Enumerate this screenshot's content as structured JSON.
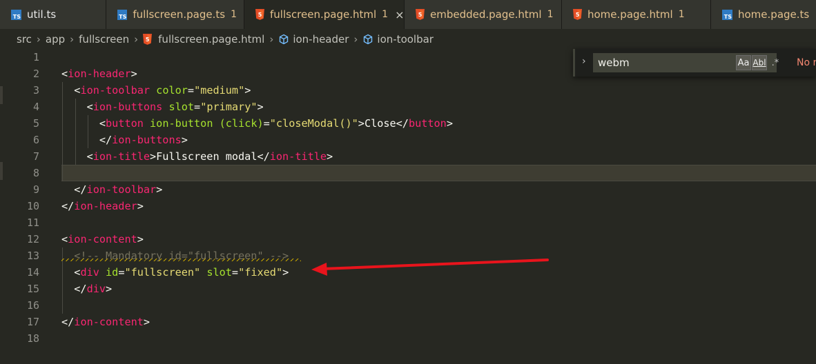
{
  "tabs": [
    {
      "icon": "ts",
      "label": "util.ts",
      "label_color": "#e8e8e8",
      "badge": "",
      "active": false,
      "closable": false
    },
    {
      "icon": "ts",
      "label": "fullscreen.page.ts",
      "label_color": "#e2c08d",
      "badge": "1",
      "active": false,
      "closable": false
    },
    {
      "icon": "html",
      "label": "fullscreen.page.html",
      "label_color": "#e2c08d",
      "badge": "1",
      "active": true,
      "closable": true
    },
    {
      "icon": "html",
      "label": "embedded.page.html",
      "label_color": "#e2c08d",
      "badge": "1",
      "active": false,
      "closable": false
    },
    {
      "icon": "html",
      "label": "home.page.html",
      "label_color": "#e2c08d",
      "badge": "1",
      "active": false,
      "closable": false
    },
    {
      "icon": "ts",
      "label": "home.page.ts",
      "label_color": "#e2c08d",
      "badge": "",
      "active": false,
      "closable": false
    }
  ],
  "tab_icon_text": "TS",
  "tab_close": "×",
  "breadcrumb": {
    "sep": "›",
    "items": [
      "src",
      "app",
      "fullscreen",
      "fullscreen.page.html",
      "ion-header",
      "ion-toolbar"
    ]
  },
  "find": {
    "chevron": "›",
    "value": "webm",
    "match_case": "Aa",
    "whole_word": "Abl",
    "regex": ".*",
    "status": "No results"
  },
  "editor": {
    "current_line": 8,
    "lines": [
      {
        "n": "1",
        "tokens": []
      },
      {
        "n": "2",
        "tokens": [
          [
            "p",
            "<"
          ],
          [
            "t",
            "ion-header"
          ],
          [
            "p",
            ">"
          ]
        ]
      },
      {
        "n": "3",
        "tokens": [
          [
            "p",
            "  <"
          ],
          [
            "t",
            "ion-toolbar"
          ],
          [
            "a",
            " color"
          ],
          [
            "p",
            "="
          ],
          [
            "s",
            "\"medium\""
          ],
          [
            "p",
            ">"
          ]
        ]
      },
      {
        "n": "4",
        "tokens": [
          [
            "p",
            "    <"
          ],
          [
            "t",
            "ion-buttons"
          ],
          [
            "a",
            " slot"
          ],
          [
            "p",
            "="
          ],
          [
            "s",
            "\"primary\""
          ],
          [
            "p",
            ">"
          ]
        ]
      },
      {
        "n": "5",
        "tokens": [
          [
            "p",
            "      <"
          ],
          [
            "t",
            "button"
          ],
          [
            "a",
            " ion-button (click)"
          ],
          [
            "p",
            "="
          ],
          [
            "s",
            "\"closeModal()\""
          ],
          [
            "p",
            ">Close</"
          ],
          [
            "t",
            "button"
          ],
          [
            "p",
            ">"
          ]
        ]
      },
      {
        "n": "6",
        "tokens": [
          [
            "p",
            "      </"
          ],
          [
            "t",
            "ion-buttons"
          ],
          [
            "p",
            ">"
          ]
        ]
      },
      {
        "n": "7",
        "tokens": [
          [
            "p",
            "    <"
          ],
          [
            "t",
            "ion-title"
          ],
          [
            "p",
            ">Fullscreen modal</"
          ],
          [
            "t",
            "ion-title"
          ],
          [
            "p",
            ">"
          ]
        ]
      },
      {
        "n": "8",
        "tokens": []
      },
      {
        "n": "9",
        "tokens": [
          [
            "p",
            "  </"
          ],
          [
            "t",
            "ion-toolbar"
          ],
          [
            "p",
            ">"
          ]
        ]
      },
      {
        "n": "10",
        "tokens": [
          [
            "p",
            "</"
          ],
          [
            "t",
            "ion-header"
          ],
          [
            "p",
            ">"
          ]
        ]
      },
      {
        "n": "11",
        "tokens": []
      },
      {
        "n": "12",
        "tokens": [
          [
            "p",
            "<"
          ],
          [
            "t",
            "ion-content"
          ],
          [
            "p",
            ">"
          ]
        ]
      },
      {
        "n": "13",
        "tokens": [
          [
            "c",
            "  <!-- Mandatory id=\"fullscreen\" -->"
          ]
        ]
      },
      {
        "n": "14",
        "tokens": [
          [
            "p",
            "  <"
          ],
          [
            "t",
            "div"
          ],
          [
            "a",
            " id"
          ],
          [
            "p",
            "="
          ],
          [
            "s",
            "\"fullscreen\""
          ],
          [
            "a",
            " slot"
          ],
          [
            "p",
            "="
          ],
          [
            "s",
            "\"fixed\""
          ],
          [
            "p",
            ">"
          ]
        ]
      },
      {
        "n": "15",
        "tokens": [
          [
            "p",
            "  </"
          ],
          [
            "t",
            "div"
          ],
          [
            "p",
            ">"
          ]
        ]
      },
      {
        "n": "16",
        "tokens": []
      },
      {
        "n": "17",
        "tokens": [
          [
            "p",
            "</"
          ],
          [
            "t",
            "ion-content"
          ],
          [
            "p",
            ">"
          ]
        ]
      },
      {
        "n": "18",
        "tokens": []
      }
    ]
  },
  "colors": {
    "tag": "#f92672",
    "attr": "#a6e22e",
    "string": "#e6db74",
    "comment": "#75715e",
    "arrow": "#e8141c",
    "ts_icon": "#2f7bc4",
    "html_icon": "#e44d26"
  }
}
